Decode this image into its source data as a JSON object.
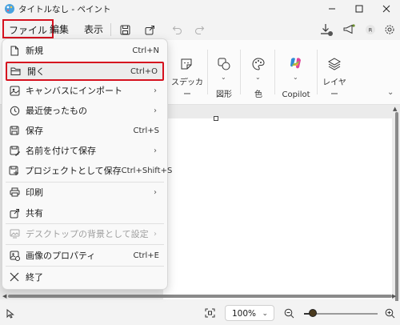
{
  "window": {
    "title": "タイトルなし - ペイント"
  },
  "menubar": {
    "file": "ファイル",
    "edit": "編集",
    "view": "表示"
  },
  "ribbon": {
    "sticker": "ステッカー",
    "shapes": "図形",
    "color": "色",
    "copilot": "Copilot",
    "layers": "レイヤー"
  },
  "file_menu": {
    "new": {
      "label": "新規",
      "shortcut": "Ctrl+N"
    },
    "open": {
      "label": "開く",
      "shortcut": "Ctrl+O"
    },
    "import": {
      "label": "キャンバスにインポート"
    },
    "recent": {
      "label": "最近使ったもの"
    },
    "save": {
      "label": "保存",
      "shortcut": "Ctrl+S"
    },
    "save_as": {
      "label": "名前を付けて保存"
    },
    "save_project": {
      "label": "プロジェクトとして保存",
      "shortcut": "Ctrl+Shift+S"
    },
    "print": {
      "label": "印刷"
    },
    "share": {
      "label": "共有"
    },
    "set_background": {
      "label": "デスクトップの背景として設定"
    },
    "properties": {
      "label": "画像のプロパティ",
      "shortcut": "Ctrl+E"
    },
    "exit": {
      "label": "終了"
    }
  },
  "statusbar": {
    "zoom": "100%"
  },
  "colors": {
    "highlight": "#d6121f",
    "dropdown_bg": "#f9f9f9",
    "canvas_bg": "#ebebeb"
  },
  "icons": [
    "paint-icon",
    "minimize-icon",
    "maximize-icon",
    "close-icon",
    "save-icon",
    "share-icon",
    "undo-icon",
    "redo-icon",
    "download-icon",
    "megaphone-icon",
    "account-icon",
    "gear-icon",
    "sticker-icon",
    "shapes-icon",
    "palette-icon",
    "copilot-icon",
    "layers-icon",
    "new-file-icon",
    "folder-open-icon",
    "import-icon",
    "history-icon",
    "save-icon",
    "save-as-icon",
    "project-icon",
    "print-icon",
    "share-icon",
    "wallpaper-icon",
    "properties-icon",
    "exit-icon",
    "pointer-icon",
    "fit-icon",
    "zoom-out-icon",
    "zoom-in-icon"
  ]
}
